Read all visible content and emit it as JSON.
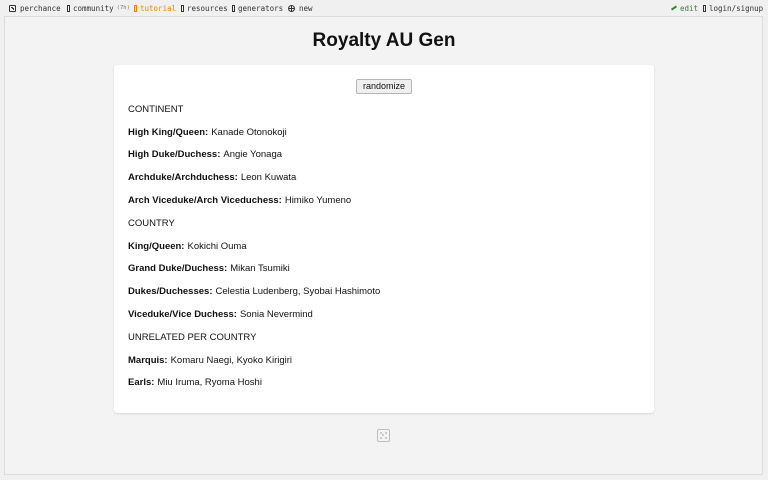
{
  "nav": {
    "perchance": "perchance",
    "community": "community",
    "community_badge": "(7h)",
    "tutorial": "tutorial",
    "resources": "resources",
    "generators": "generators",
    "new": "new",
    "edit": "edit",
    "login": "login/signup"
  },
  "page": {
    "title": "Royalty AU Gen",
    "randomize_label": "randomize"
  },
  "content": {
    "continent_heading": "CONTINENT",
    "high_king": {
      "label": "High King/Queen:",
      "value": "Kanade Otonokoji"
    },
    "high_duke": {
      "label": "High Duke/Duchess:",
      "value": "Angie Yonaga"
    },
    "archduke": {
      "label": "Archduke/Archduchess:",
      "value": "Leon Kuwata"
    },
    "arch_viceduke": {
      "label": "Arch Viceduke/Arch Viceduchess:",
      "value": "Himiko Yumeno"
    },
    "country_heading": "COUNTRY",
    "king": {
      "label": "King/Queen:",
      "value": "Kokichi Ouma"
    },
    "grand_duke": {
      "label": "Grand Duke/Duchess:",
      "value": "Mikan Tsumiki"
    },
    "dukes": {
      "label": "Dukes/Duchesses:",
      "value": "Celestia Ludenberg, Syobai Hashimoto"
    },
    "viceduke": {
      "label": "Viceduke/Vice Duchess:",
      "value": "Sonia Nevermind"
    },
    "unrelated_heading": "UNRELATED PER COUNTRY",
    "marquis": {
      "label": "Marquis:",
      "value": "Komaru Naegi, Kyoko Kirigiri"
    },
    "earls": {
      "label": "Earls:",
      "value": "Miu Iruma, Ryoma Hoshi"
    }
  },
  "colors": {
    "accent_tutorial": "#e08a00",
    "edit_green": "#2a8a2a",
    "background": "#f0f0f0",
    "card": "#ffffff"
  }
}
